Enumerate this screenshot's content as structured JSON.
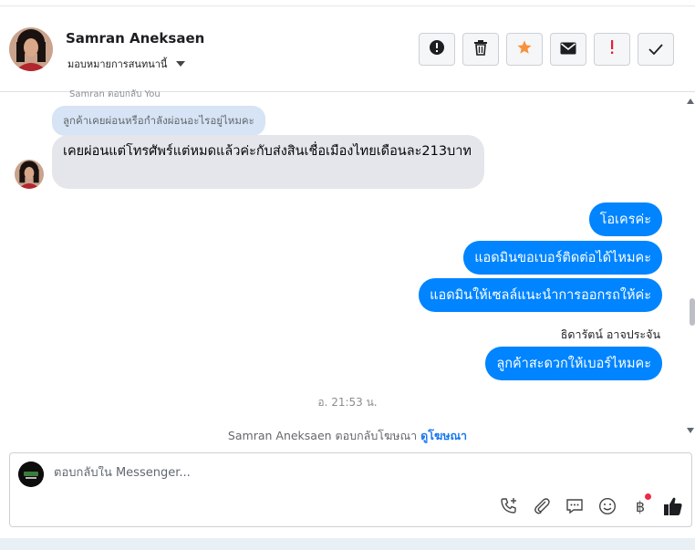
{
  "header": {
    "contact_name": "Samran Aneksaen",
    "assign_label": "มอบหมายการสนทนานี้",
    "actions": [
      {
        "name": "spam-button",
        "icon": "alert-circle-icon"
      },
      {
        "name": "delete-button",
        "icon": "trash-icon"
      },
      {
        "name": "star-button",
        "icon": "star-icon"
      },
      {
        "name": "mark-unread-button",
        "icon": "envelope-icon"
      },
      {
        "name": "follow-up-button",
        "icon": "exclamation-icon"
      },
      {
        "name": "mark-done-button",
        "icon": "check-icon"
      }
    ]
  },
  "conversation": {
    "reply_label": "Samran ตอบกลับ You",
    "quoted_text": "ลูกค้าเคยผ่อนหรือกำลังผ่อนอะไรอยู่ไหมคะ",
    "incoming_message": "เคยผ่อนแต่โทรศัพร์แต่หมดแล้วค่ะกับส่งสินเชื่อเมืองไทยเดือนละ213บาท",
    "outgoing_messages": [
      "โอเครค่ะ",
      "แอดมินขอเบอร์ติดต่อได้ไหมคะ",
      "แอดมินให้เซลล์แนะนำการออกรถให้ค่ะ",
      "ลูกค้าสะดวกให้เบอร์ไหมคะ"
    ],
    "sender_name": "ธิดารัตน์ อาจประจัน",
    "timestamp": "อ. 21:53 น.",
    "ad_note_prefix": "Samran Aneksaen ตอบกลับโฆษณา",
    "ad_note_link": "ดูโฆษณา"
  },
  "composer": {
    "placeholder": "ตอบกลับใน Messenger...",
    "tools": [
      "call-add-icon",
      "paperclip-icon",
      "saved-reply-icon",
      "emoji-icon",
      "baht-payment-icon",
      "like-icon"
    ]
  },
  "colors": {
    "outgoing_bubble": "#0084ff",
    "incoming_bubble": "#e4e6eb",
    "quote_bubble": "#d6e4f5",
    "star": "#f7923b",
    "alert_red": "#e41e3f"
  }
}
